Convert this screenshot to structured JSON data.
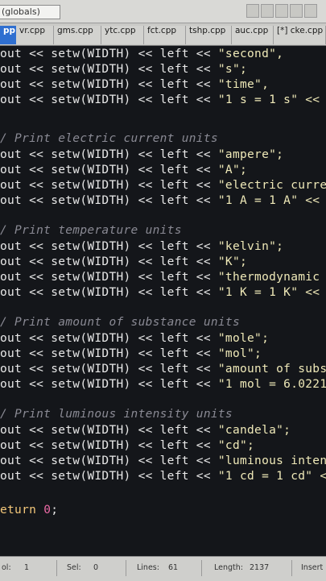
{
  "toolbar": {
    "scope_value": "(globals)"
  },
  "tabs": [
    {
      "label": "pp",
      "active": true
    },
    {
      "label": "vr.cpp",
      "active": false
    },
    {
      "label": "gms.cpp",
      "active": false
    },
    {
      "label": "ytc.cpp",
      "active": false
    },
    {
      "label": "fct.cpp",
      "active": false
    },
    {
      "label": "tshp.cpp",
      "active": false
    },
    {
      "label": "auc.cpp",
      "active": false
    },
    {
      "label": "[*] cke.cpp",
      "active": false
    }
  ],
  "code": {
    "l1": {
      "pre": "out << setw(WIDTH) << left << ",
      "str": "\"second\","
    },
    "l2": {
      "pre": "out << setw(WIDTH) << left << ",
      "str": "\"s\";"
    },
    "l3": {
      "pre": "out << setw(WIDTH) << left << ",
      "str": "\"time\","
    },
    "l4": {
      "pre": "out << setw(WIDTH) << left << ",
      "str": "\"1 s = 1 s\" <<"
    },
    "c_current": "/ Print electric current units",
    "l5": {
      "pre": "out << setw(WIDTH) << left << ",
      "str": "\"ampere\";"
    },
    "l6": {
      "pre": "out << setw(WIDTH) << left << ",
      "str": "\"A\";"
    },
    "l7": {
      "pre": "out << setw(WIDTH) << left << ",
      "str": "\"electric curre"
    },
    "l8": {
      "pre": "out << setw(WIDTH) << left << ",
      "str": "\"1 A = 1 A\" <<"
    },
    "c_temp": "/ Print temperature units",
    "l9": {
      "pre": "out << setw(WIDTH) << left << ",
      "str": "\"kelvin\";"
    },
    "l10": {
      "pre": "out << setw(WIDTH) << left << ",
      "str": "\"K\";"
    },
    "l11": {
      "pre": "out << setw(WIDTH) << left << ",
      "str": "\"thermodynamic"
    },
    "l12": {
      "pre": "out << setw(WIDTH) << left << ",
      "str": "\"1 K = 1 K\" <<"
    },
    "c_amount": "/ Print amount of substance units",
    "l13": {
      "pre": "out << setw(WIDTH) << left << ",
      "str": "\"mole\";"
    },
    "l14": {
      "pre": "out << setw(WIDTH) << left << ",
      "str": "\"mol\";"
    },
    "l15": {
      "pre": "out << setw(WIDTH) << left << ",
      "str": "\"amount of subst"
    },
    "l16": {
      "pre": "out << setw(WIDTH) << left << ",
      "str": "\"1 mol = 6.02214"
    },
    "c_lum": "/ Print luminous intensity units",
    "l17": {
      "pre": "out << setw(WIDTH) << left << ",
      "str": "\"candela\";"
    },
    "l18": {
      "pre": "out << setw(WIDTH) << left << ",
      "str": "\"cd\";"
    },
    "l19": {
      "pre": "out << setw(WIDTH) << left << ",
      "str": "\"luminous intens"
    },
    "l20": {
      "pre": "out << setw(WIDTH) << left << ",
      "str": "\"1 cd = 1 cd\" <<"
    },
    "ret_kw": "eturn ",
    "ret_num": "0",
    "ret_end": ";"
  },
  "status": {
    "col_label": "ol:",
    "col_value": "1",
    "sel_label": "Sel:",
    "sel_value": "0",
    "lines_label": "Lines:",
    "lines_value": "61",
    "length_label": "Length:",
    "length_value": "2137",
    "mode": "Insert"
  },
  "colors": {
    "editor_bg": "#14161a",
    "tab_active": "#2f6fd0",
    "string": "#efe9b8",
    "comment": "#8a8a94",
    "keyword_return": "#f4c87a",
    "number": "#ec6aa5"
  }
}
